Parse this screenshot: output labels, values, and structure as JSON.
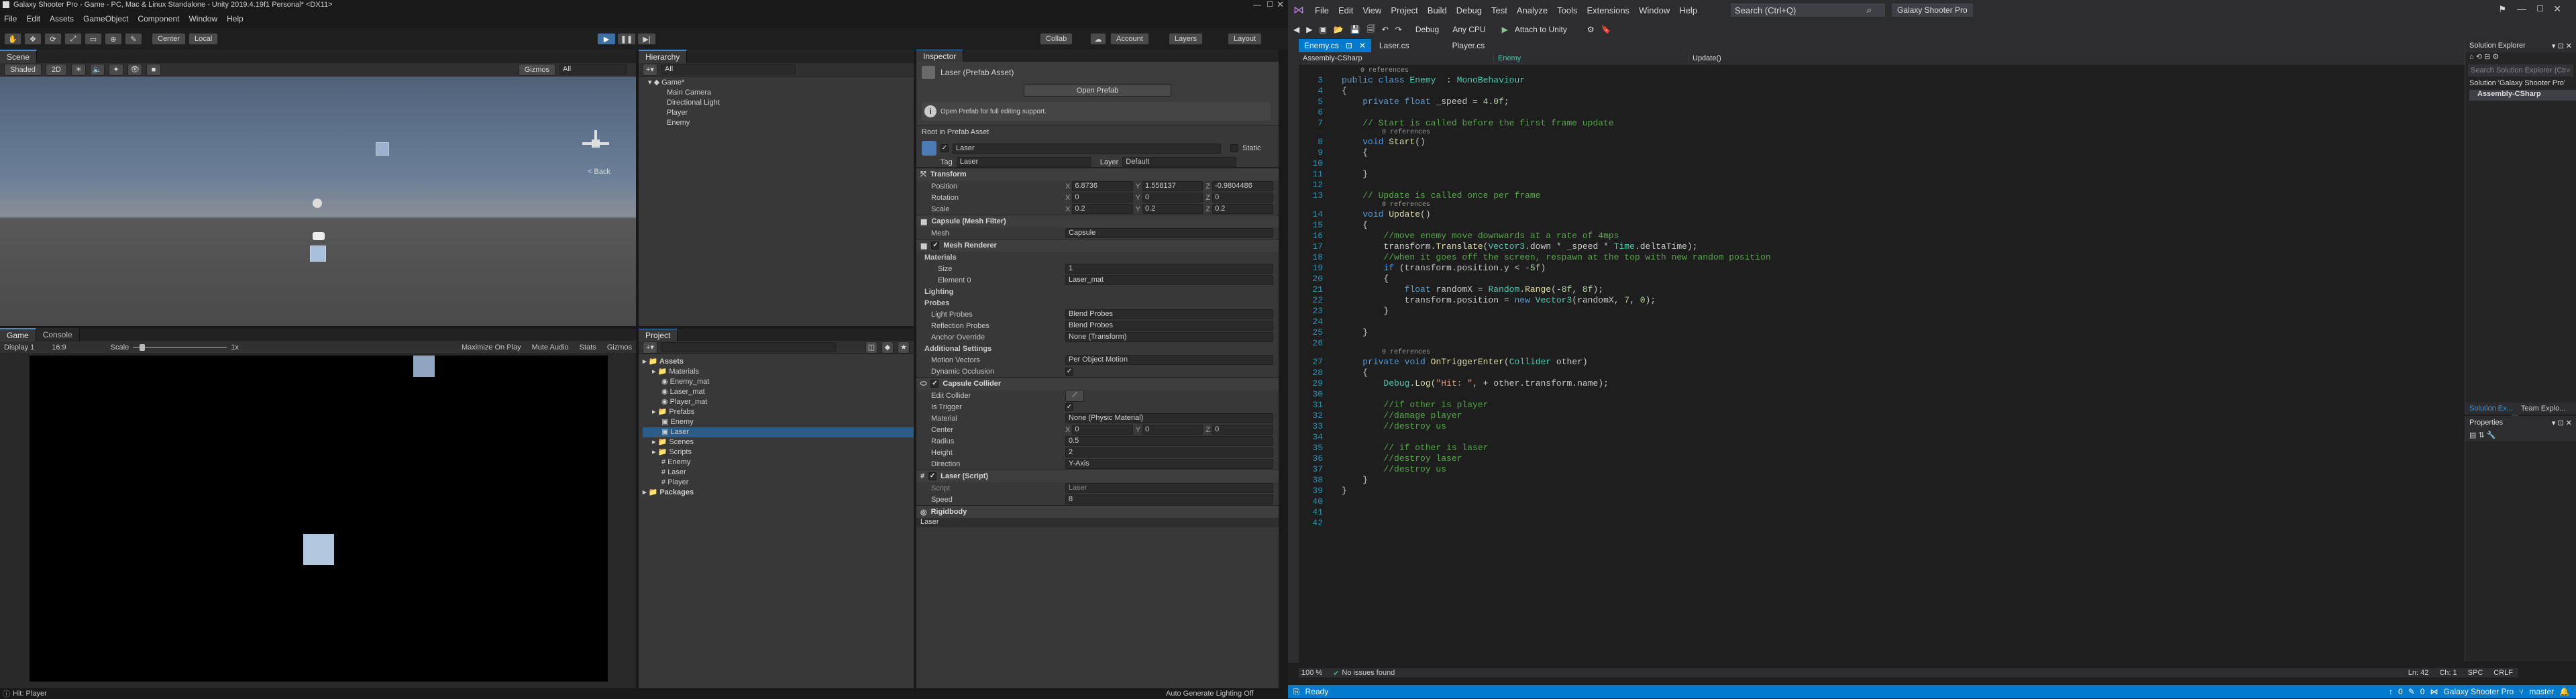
{
  "unity": {
    "title": "Galaxy Shooter Pro - Game - PC, Mac & Linux Standalone - Unity 2019.4.19f1 Personal* <DX11>",
    "menu": [
      "File",
      "Edit",
      "Assets",
      "GameObject",
      "Component",
      "Window",
      "Help"
    ],
    "toolbar": {
      "center": "Center",
      "local": "Local",
      "collab": "Collab",
      "account": "Account",
      "layers": "Layers",
      "layout": "Layout"
    },
    "scene": {
      "tab": "Scene",
      "shading": "Shaded",
      "mode2d": "2D",
      "gizmos": "Gizmos",
      "search": "All",
      "back": "< Back"
    },
    "game": {
      "tab": "Game",
      "console_tab": "Console",
      "display": "Display 1",
      "aspect": "16:9",
      "scale_label": "Scale",
      "scale_value": "1x",
      "maximize": "Maximize On Play",
      "mute": "Mute Audio",
      "stats": "Stats",
      "gizmos": "Gizmos"
    },
    "hierarchy": {
      "tab": "Hierarchy",
      "search": "All",
      "scene_name": "Game*",
      "items": [
        "Main Camera",
        "Directional Light",
        "Player",
        "Enemy"
      ]
    },
    "project": {
      "tab": "Project",
      "items": [
        {
          "label": "Assets",
          "depth": 0,
          "type": "folder",
          "bold": true
        },
        {
          "label": "Materials",
          "depth": 1,
          "type": "folder"
        },
        {
          "label": "Enemy_mat",
          "depth": 2,
          "type": "mat"
        },
        {
          "label": "Laser_mat",
          "depth": 2,
          "type": "mat"
        },
        {
          "label": "Player_mat",
          "depth": 2,
          "type": "mat"
        },
        {
          "label": "Prefabs",
          "depth": 1,
          "type": "folder"
        },
        {
          "label": "Enemy",
          "depth": 2,
          "type": "prefab"
        },
        {
          "label": "Laser",
          "depth": 2,
          "type": "prefab",
          "selected": true
        },
        {
          "label": "Scenes",
          "depth": 1,
          "type": "folder"
        },
        {
          "label": "Scripts",
          "depth": 1,
          "type": "folder"
        },
        {
          "label": "Enemy",
          "depth": 2,
          "type": "script"
        },
        {
          "label": "Laser",
          "depth": 2,
          "type": "script"
        },
        {
          "label": "Player",
          "depth": 2,
          "type": "script"
        },
        {
          "label": "Packages",
          "depth": 0,
          "type": "folder",
          "bold": true
        }
      ]
    },
    "inspector": {
      "tab": "Inspector",
      "asset_title": "Laser (Prefab Asset)",
      "open_prefab": "Open Prefab",
      "info": "Open Prefab for full editing support.",
      "root_label": "Root in Prefab Asset",
      "name": "Laser",
      "static": "Static",
      "tag_label": "Tag",
      "tag": "Laser",
      "layer_label": "Layer",
      "layer": "Default",
      "transform": {
        "title": "Transform",
        "position": {
          "label": "Position",
          "x": "6.8736",
          "y": "1.558137",
          "z": "-0.9804486"
        },
        "rotation": {
          "label": "Rotation",
          "x": "0",
          "y": "0",
          "z": "0"
        },
        "scale": {
          "label": "Scale",
          "x": "0.2",
          "y": "0.2",
          "z": "0.2"
        }
      },
      "mesh_filter": {
        "title": "Capsule (Mesh Filter)",
        "mesh_label": "Mesh",
        "mesh": "Capsule"
      },
      "mesh_renderer": {
        "title": "Mesh Renderer",
        "materials": "Materials",
        "size_label": "Size",
        "size": "1",
        "element_label": "Element 0",
        "element": "Laser_mat",
        "lighting": "Lighting",
        "probes": "Probes",
        "light_probes_label": "Light Probes",
        "light_probes": "Blend Probes",
        "reflection_label": "Reflection Probes",
        "reflection": "Blend Probes",
        "anchor_label": "Anchor Override",
        "anchor": "None (Transform)",
        "additional": "Additional Settings",
        "motion_label": "Motion Vectors",
        "motion": "Per Object Motion",
        "occlusion_label": "Dynamic Occlusion"
      },
      "collider": {
        "title": "Capsule Collider",
        "edit_label": "Edit Collider",
        "trigger_label": "Is Trigger",
        "material_label": "Material",
        "material": "None (Physic Material)",
        "center_label": "Center",
        "cx": "0",
        "cy": "0",
        "cz": "0",
        "radius_label": "Radius",
        "radius": "0.5",
        "height_label": "Height",
        "height": "2",
        "direction_label": "Direction",
        "direction": "Y-Axis"
      },
      "script": {
        "title": "Laser (Script)",
        "script_label": "Script",
        "script": "Laser",
        "speed_label": "Speed",
        "speed": "8"
      },
      "rigidbody": {
        "title": "Rigidbody"
      },
      "footer": "Laser"
    },
    "status": {
      "message": "Hit: Player",
      "lighting": "Auto Generate Lighting Off"
    }
  },
  "vs": {
    "menu": [
      "File",
      "Edit",
      "View",
      "Project",
      "Build",
      "Debug",
      "Test",
      "Analyze",
      "Tools",
      "Extensions",
      "Window",
      "Help"
    ],
    "search_placeholder": "Search (Ctrl+Q)",
    "solution_name": "Galaxy Shooter Pro",
    "toolbar": {
      "config": "Debug",
      "platform": "Any CPU",
      "attach": "Attach to Unity"
    },
    "tabs": [
      {
        "label": "Enemy.cs",
        "active": true
      },
      {
        "label": "Laser.cs"
      },
      {
        "label": "Player.cs"
      }
    ],
    "nav": {
      "project": "Assembly-CSharp",
      "class": "Enemy",
      "member": "Update()"
    },
    "code": [
      {
        "n": "3",
        "refs": "0 references",
        "parts": [
          [
            "kw",
            "public "
          ],
          [
            "kw",
            "class "
          ],
          [
            "ty",
            "Enemy"
          ],
          [
            "",
            "  : "
          ],
          [
            "ty",
            "MonoBehaviour"
          ]
        ]
      },
      {
        "n": "4",
        "parts": [
          [
            "",
            "{"
          ]
        ]
      },
      {
        "n": "5",
        "parts": [
          [
            "",
            "    "
          ],
          [
            "kw",
            "private "
          ],
          [
            "kw",
            "float "
          ],
          [
            "",
            "_speed = "
          ],
          [
            "nm",
            "4.0f"
          ],
          [
            "",
            ";"
          ]
        ]
      },
      {
        "n": "6",
        "parts": [
          [
            "",
            ""
          ]
        ]
      },
      {
        "n": "7",
        "parts": [
          [
            "",
            "    "
          ],
          [
            "cm",
            "// Start is called before the first frame update"
          ]
        ]
      },
      {
        "n": "8",
        "refs": "0 references",
        "parts": [
          [
            "",
            "    "
          ],
          [
            "kw",
            "void "
          ],
          [
            "fn",
            "Start"
          ],
          [
            "",
            "()"
          ]
        ]
      },
      {
        "n": "9",
        "parts": [
          [
            "",
            "    {"
          ]
        ]
      },
      {
        "n": "10",
        "parts": [
          [
            "",
            ""
          ]
        ]
      },
      {
        "n": "11",
        "parts": [
          [
            "",
            "    }"
          ]
        ]
      },
      {
        "n": "12",
        "parts": [
          [
            "",
            ""
          ]
        ]
      },
      {
        "n": "13",
        "parts": [
          [
            "",
            "    "
          ],
          [
            "cm",
            "// Update is called once per frame"
          ]
        ]
      },
      {
        "n": "14",
        "refs": "0 references",
        "parts": [
          [
            "",
            "    "
          ],
          [
            "kw",
            "void "
          ],
          [
            "fn",
            "Update"
          ],
          [
            "",
            "()"
          ]
        ]
      },
      {
        "n": "15",
        "parts": [
          [
            "",
            "    {"
          ]
        ]
      },
      {
        "n": "16",
        "parts": [
          [
            "",
            "        "
          ],
          [
            "cm",
            "//move enemy move downwards at a rate of 4mps"
          ]
        ]
      },
      {
        "n": "17",
        "parts": [
          [
            "",
            "        transform."
          ],
          [
            "fn",
            "Translate"
          ],
          [
            "",
            "("
          ],
          [
            "ty",
            "Vector3"
          ],
          [
            "",
            ".down * _speed * "
          ],
          [
            "ty",
            "Time"
          ],
          [
            "",
            ".deltaTime);"
          ]
        ]
      },
      {
        "n": "18",
        "parts": [
          [
            "",
            "        "
          ],
          [
            "cm",
            "//when it goes off the screen, respawn at the top with new random position"
          ]
        ]
      },
      {
        "n": "19",
        "parts": [
          [
            "",
            "        "
          ],
          [
            "kw",
            "if "
          ],
          [
            "",
            "(transform.position.y < -"
          ],
          [
            "nm",
            "5f"
          ],
          [
            "",
            ")"
          ]
        ]
      },
      {
        "n": "20",
        "parts": [
          [
            "",
            "        {"
          ]
        ]
      },
      {
        "n": "21",
        "parts": [
          [
            "",
            "            "
          ],
          [
            "kw",
            "float "
          ],
          [
            "",
            "randomX = "
          ],
          [
            "ty",
            "Random"
          ],
          [
            "",
            "."
          ],
          [
            "fn",
            "Range"
          ],
          [
            "",
            "(-"
          ],
          [
            "nm",
            "8f"
          ],
          [
            "",
            ", "
          ],
          [
            "nm",
            "8f"
          ],
          [
            "",
            ");"
          ]
        ]
      },
      {
        "n": "22",
        "parts": [
          [
            "",
            "            transform.position = "
          ],
          [
            "kw",
            "new "
          ],
          [
            "ty",
            "Vector3"
          ],
          [
            "",
            "(randomX, "
          ],
          [
            "nm",
            "7"
          ],
          [
            "",
            ", "
          ],
          [
            "nm",
            "0"
          ],
          [
            "",
            ");"
          ]
        ]
      },
      {
        "n": "23",
        "parts": [
          [
            "",
            "        }"
          ]
        ]
      },
      {
        "n": "24",
        "parts": [
          [
            "",
            ""
          ]
        ]
      },
      {
        "n": "25",
        "parts": [
          [
            "",
            "    }"
          ]
        ]
      },
      {
        "n": "26",
        "parts": [
          [
            "",
            ""
          ]
        ]
      },
      {
        "n": "27",
        "refs": "0 references",
        "parts": [
          [
            "",
            "    "
          ],
          [
            "kw",
            "private "
          ],
          [
            "kw",
            "void "
          ],
          [
            "fn",
            "OnTriggerEnter"
          ],
          [
            "",
            "("
          ],
          [
            "ty",
            "Collider"
          ],
          [
            "",
            " other)"
          ]
        ]
      },
      {
        "n": "28",
        "parts": [
          [
            "",
            "    {"
          ]
        ]
      },
      {
        "n": "29",
        "parts": [
          [
            "",
            "        "
          ],
          [
            "ty",
            "Debug"
          ],
          [
            "",
            "."
          ],
          [
            "fn",
            "Log"
          ],
          [
            "",
            "("
          ],
          [
            "st",
            "\"Hit: \""
          ],
          [
            "",
            ", + other.transform.name);"
          ]
        ]
      },
      {
        "n": "30",
        "parts": [
          [
            "",
            ""
          ]
        ]
      },
      {
        "n": "31",
        "parts": [
          [
            "",
            "        "
          ],
          [
            "cm",
            "//if other is player"
          ]
        ]
      },
      {
        "n": "32",
        "parts": [
          [
            "",
            "        "
          ],
          [
            "cm",
            "//damage player"
          ]
        ]
      },
      {
        "n": "33",
        "parts": [
          [
            "",
            "        "
          ],
          [
            "cm",
            "//destroy us"
          ]
        ]
      },
      {
        "n": "34",
        "parts": [
          [
            "",
            ""
          ]
        ]
      },
      {
        "n": "35",
        "parts": [
          [
            "",
            "        "
          ],
          [
            "cm",
            "// if other is laser"
          ]
        ]
      },
      {
        "n": "36",
        "parts": [
          [
            "",
            "        "
          ],
          [
            "cm",
            "//destroy laser"
          ]
        ]
      },
      {
        "n": "37",
        "parts": [
          [
            "",
            "        "
          ],
          [
            "cm",
            "//destroy us"
          ]
        ]
      },
      {
        "n": "38",
        "parts": [
          [
            "",
            "    }"
          ]
        ]
      },
      {
        "n": "39",
        "parts": [
          [
            "",
            "}"
          ]
        ]
      },
      {
        "n": "40",
        "parts": [
          [
            "",
            ""
          ]
        ]
      },
      {
        "n": "41",
        "parts": [
          [
            "",
            ""
          ]
        ]
      },
      {
        "n": "42",
        "parts": [
          [
            "",
            ""
          ]
        ]
      }
    ],
    "editor_footer": {
      "zoom": "100 %",
      "issues": "No issues found",
      "pos": "Ln: 42",
      "col": "Ch: 1",
      "spc": "SPC",
      "crlf": "CRLF"
    },
    "solution_explorer": {
      "title": "Solution Explorer",
      "search": "Search Solution Explorer (Ctrl+;)",
      "solution": "Solution 'Galaxy Shooter Pro'",
      "project": "Assembly-CSharp",
      "tab1": "Solution Ex...",
      "tab2": "Team Explo..."
    },
    "properties": {
      "title": "Properties"
    },
    "status": {
      "ready": "Ready",
      "errors": "0",
      "warnings": "0",
      "solution": "Galaxy Shooter Pro",
      "branch": "master"
    }
  }
}
